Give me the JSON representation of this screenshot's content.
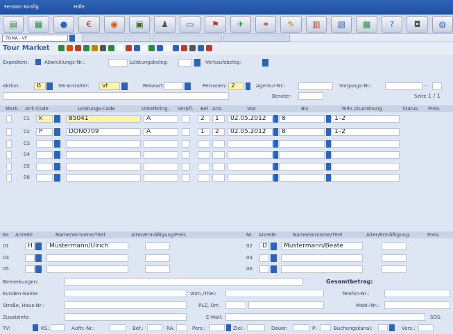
{
  "menu": {
    "items": [
      "Fenster",
      "Konfig",
      "Hilfe"
    ]
  },
  "toolbar": {
    "icons": [
      "agenda-icon",
      "document-icon",
      "globe-icon",
      "euro-icon",
      "cart-icon",
      "photo-icon",
      "people-icon",
      "car-icon",
      "flag-icon",
      "plane-icon",
      "link-icon",
      "tools-icon",
      "calendar-icon",
      "chart-icon",
      "grid-icon",
      "help-icon",
      "camera-icon",
      "world-icon"
    ]
  },
  "context": {
    "toma": "TOMA - VF",
    "title": "Tour Market"
  },
  "top": {
    "expedient": "Expedient:",
    "abwicklung": "Abwicklungs-Nr.:",
    "leistungsbeleg": "Leistungsbeleg:",
    "verkaufsbeleg": "Verkaufsbeleg:"
  },
  "action": {
    "aktion_label": "Aktion:",
    "aktion_value": "B",
    "veranstalter_label": "Veranstalter:",
    "veranstalter_value": "vf",
    "reiseart_label": "Reiseart:",
    "personen_label": "Personen:",
    "personen_value": "2",
    "agentur_label": "Agentur-Nr.:",
    "vorgang_label": "Vorgangs-Nr.:",
    "berater_label": "Berater:",
    "seite_label": "Seite",
    "seite_value": "1 / 1"
  },
  "services": {
    "headers": [
      "Mark.",
      "Anf.-Code",
      "Leistungs-Code",
      "Unterbring.",
      "Verpfl.",
      "Bel.",
      "Anz.",
      "Von",
      "Bis",
      "Teiln./Zuordnung",
      "Status",
      "Preis"
    ],
    "rows": [
      {
        "nr": "01",
        "code": "k",
        "leistung": "85041",
        "unterbringung": "A",
        "bel": "2",
        "anz": "1",
        "von": "02.05.2012",
        "bis": "8",
        "teiln": "1–2"
      },
      {
        "nr": "02",
        "code": "P",
        "leistung": "DON0709",
        "unterbringung": "A",
        "bel": "1",
        "anz": "2",
        "von": "02.05.2012",
        "bis": "8",
        "teiln": "1–2"
      },
      {
        "nr": "03",
        "code": "",
        "leistung": "",
        "unterbringung": "",
        "bel": "",
        "anz": "",
        "von": "",
        "bis": "",
        "teiln": ""
      },
      {
        "nr": "04",
        "code": "",
        "leistung": "",
        "unterbringung": "",
        "bel": "",
        "anz": "",
        "von": "",
        "bis": "",
        "teiln": ""
      },
      {
        "nr": "05",
        "code": "",
        "leistung": "",
        "unterbringung": "",
        "bel": "",
        "anz": "",
        "von": "",
        "bis": "",
        "teiln": ""
      },
      {
        "nr": "06",
        "code": "",
        "leistung": "",
        "unterbringung": "",
        "bel": "",
        "anz": "",
        "von": "",
        "bis": "",
        "teiln": ""
      }
    ]
  },
  "participants": {
    "headers": [
      "Nr.",
      "Anrede",
      "Name/Vorname/Titel",
      "Alter/Ermäßigung",
      "Preis"
    ],
    "left": [
      {
        "nr": "01",
        "anrede": "H",
        "name": "Mustermann/Ulrich"
      },
      {
        "nr": "03",
        "anrede": "",
        "name": ""
      },
      {
        "nr": "05",
        "anrede": "",
        "name": ""
      }
    ],
    "right": [
      {
        "nr": "02",
        "anrede": "D",
        "name": "Mustermann/Beate"
      },
      {
        "nr": "04",
        "anrede": "",
        "name": ""
      },
      {
        "nr": "06",
        "anrede": "",
        "name": ""
      }
    ]
  },
  "customer": {
    "bemerkungen": "Bemerkungen:",
    "gesamtbetrag": "Gesamtbetrag:",
    "kundenname": "Kunden-Name:",
    "vorn": "Vorn./Titel:",
    "telefon": "Telefon-Nr.:",
    "strasse": "Straße, Haus-Nr.:",
    "plz": "PLZ, Ort:",
    "mobil": "Mobil-Nr.:",
    "zusatzinfo": "Zusatzinfo:",
    "email": "E-Mail:",
    "sos": "SOS:"
  },
  "footer": {
    "tv": "TV:",
    "ks": "KS:",
    "auftr": "Auftr.-Nr.:",
    "bef": "Bef.:",
    "ra": "RA:",
    "pers": "Pers.:",
    "ziel": "Ziel:",
    "dauer": "Dauer:",
    "p": "P:",
    "buchungskanal": "Buchungskanal:",
    "vers": "Vers.:"
  }
}
